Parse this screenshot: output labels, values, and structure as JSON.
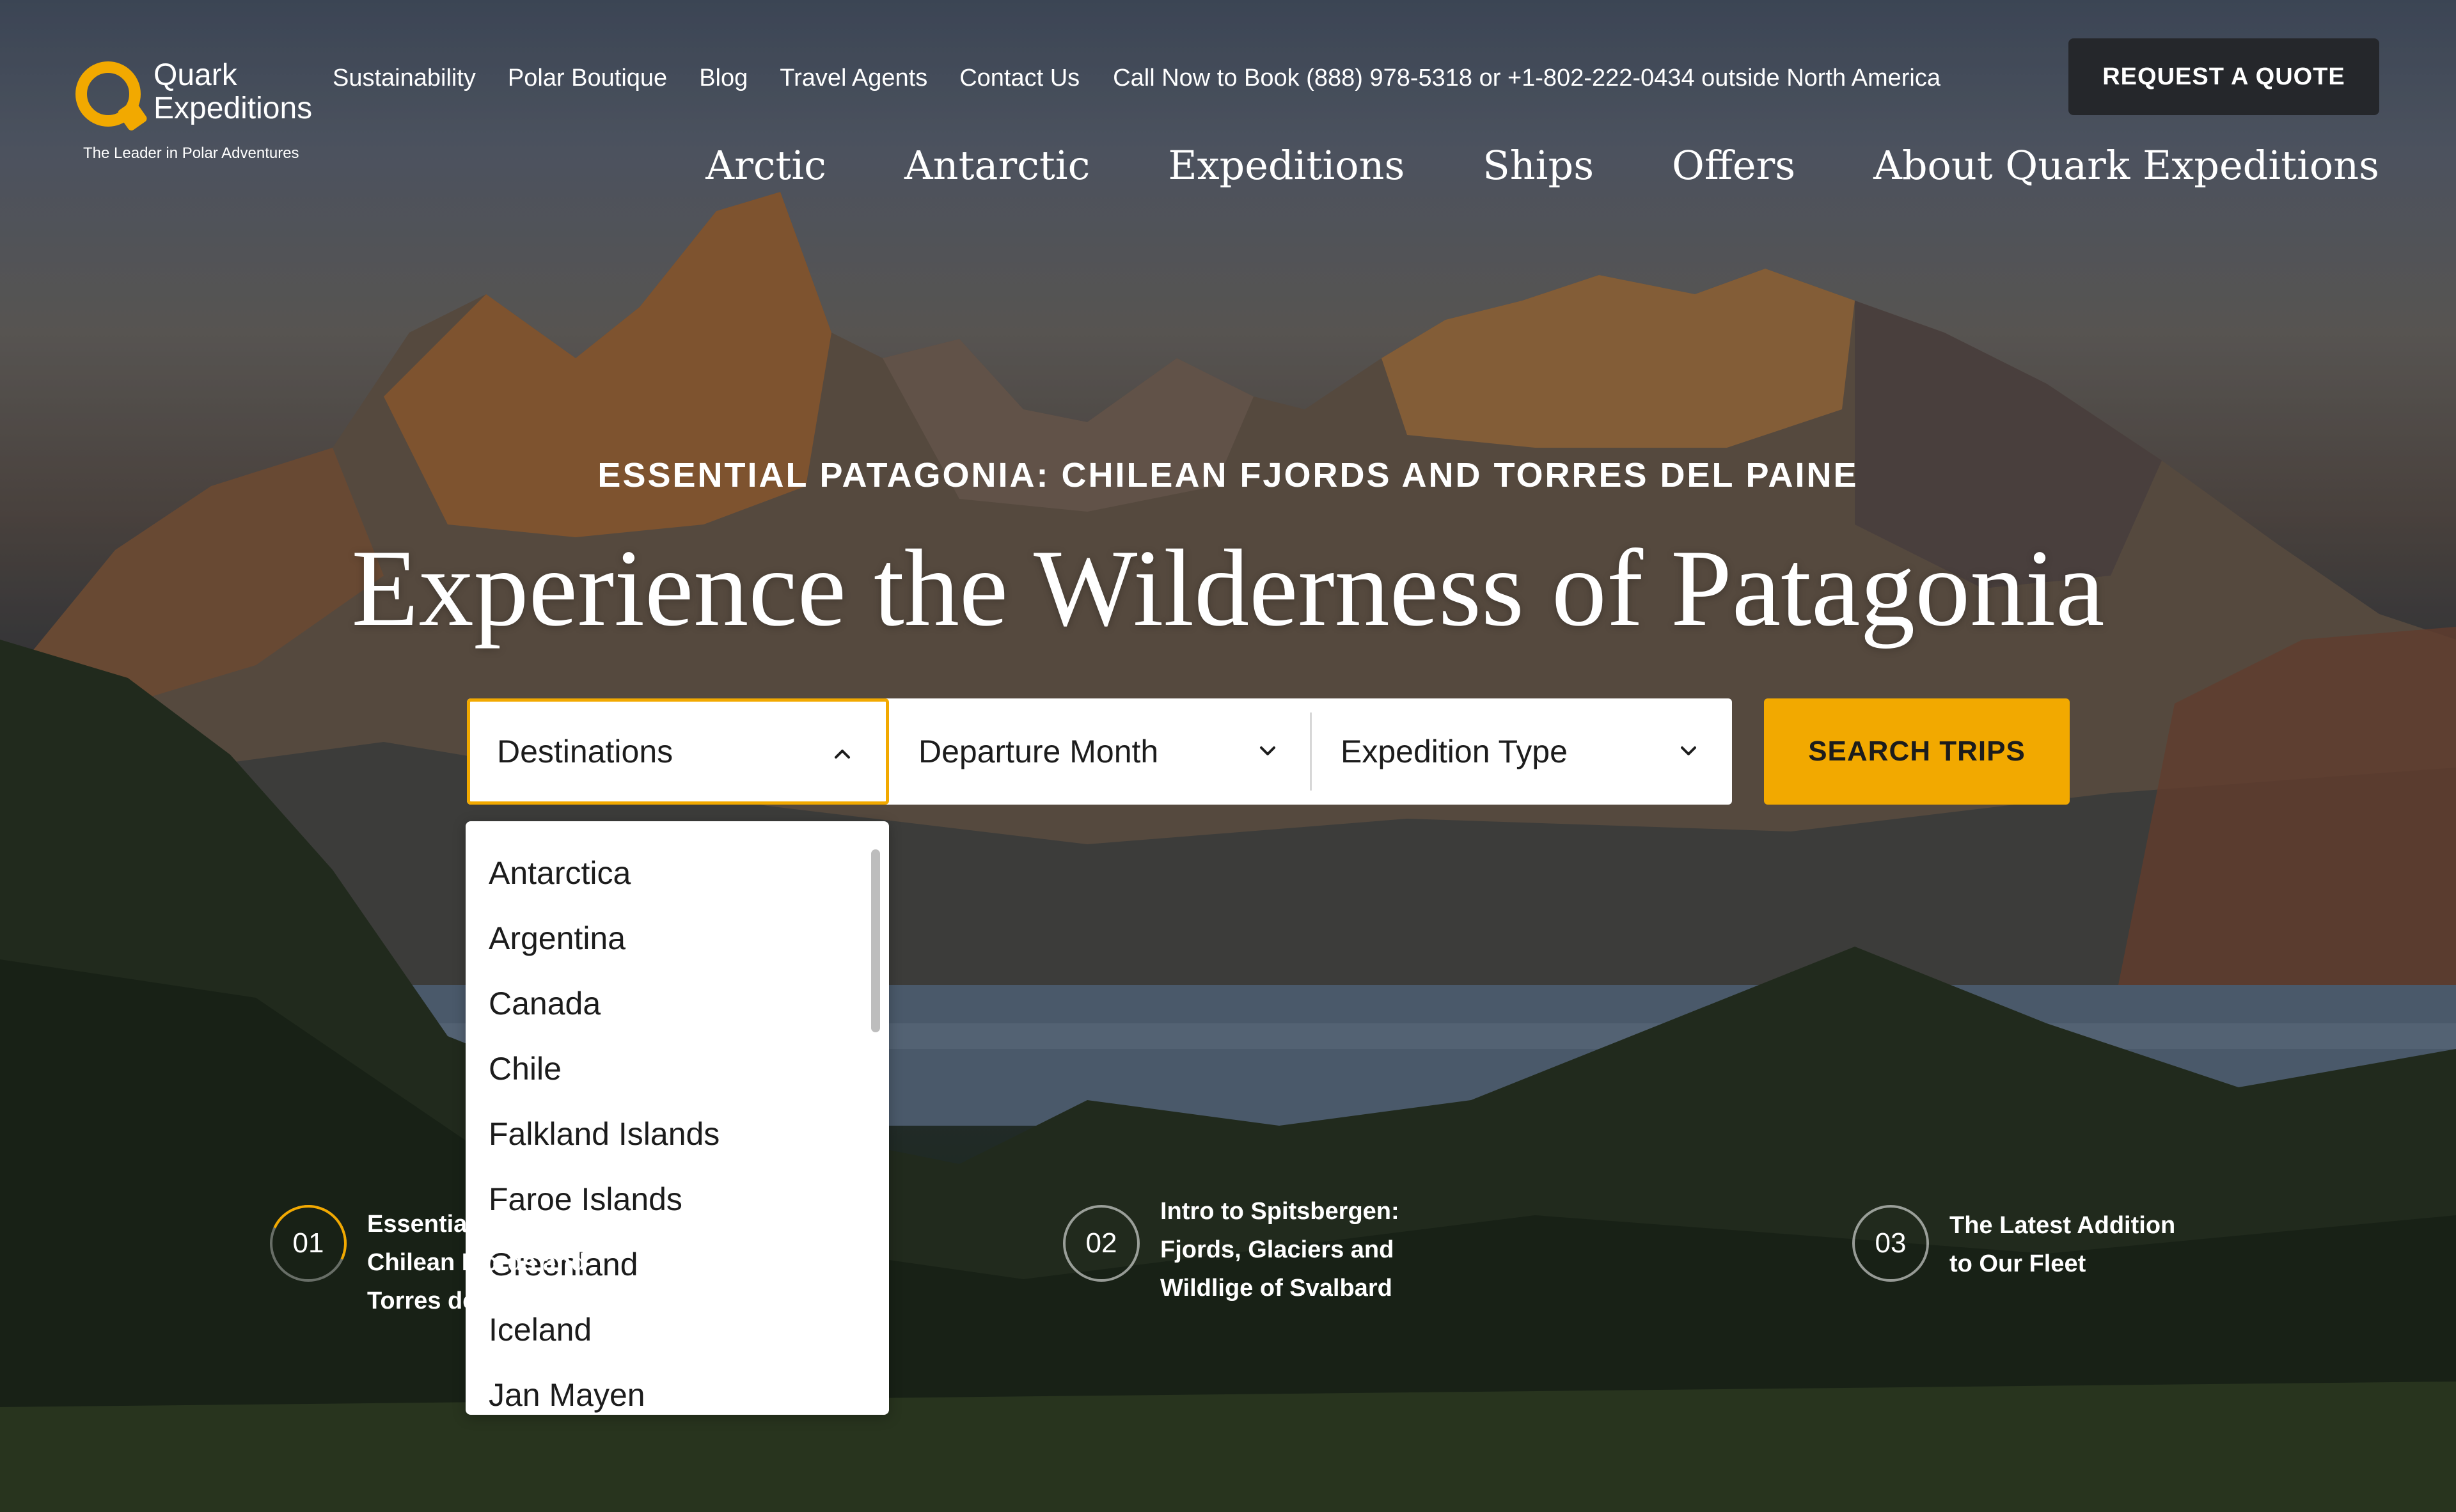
{
  "brand": {
    "logo_line1": "Quark",
    "logo_line2": "Expeditions",
    "tagline": "The Leader in Polar Adventures",
    "accent_color": "#f2a900"
  },
  "utility_nav": {
    "items": [
      "Sustainability",
      "Polar Boutique",
      "Blog",
      "Travel Agents",
      "Contact Us"
    ],
    "phone_text": "Call Now to Book (888) 978-5318 or +1-802-222-0434 outside North America",
    "quote_button": "REQUEST A QUOTE"
  },
  "main_nav": {
    "items": [
      "Arctic",
      "Antarctic",
      "Expeditions",
      "Ships",
      "Offers",
      "About Quark Expeditions"
    ]
  },
  "hero": {
    "eyebrow": "ESSENTIAL PATAGONIA: CHILEAN FJORDS AND TORRES DEL PAINE",
    "headline": "Experience the Wilderness of Patagonia"
  },
  "search": {
    "destinations_label": "Destinations",
    "month_label": "Departure Month",
    "type_label": "Expedition Type",
    "search_button": "SEARCH TRIPS",
    "destinations_open": true,
    "destination_options": [
      "Antarctica",
      "Argentina",
      "Canada",
      "Chile",
      "Falkland Islands",
      "Faroe Islands",
      "Greenland",
      "Iceland",
      "Jan Mayen"
    ]
  },
  "slides": [
    {
      "number": "01",
      "line1": "Essential Patagonia:",
      "line2": "Chilean Fjords and",
      "line3": "Torres del Paine",
      "active": true
    },
    {
      "number": "02",
      "line1": "Intro to Spitsbergen:",
      "line2": "Fjords, Glaciers and",
      "line3": "Wildlige of Svalbard",
      "active": false
    },
    {
      "number": "03",
      "line1": "The Latest Addition",
      "line2": "to Our Fleet",
      "line3": "",
      "active": false
    }
  ]
}
